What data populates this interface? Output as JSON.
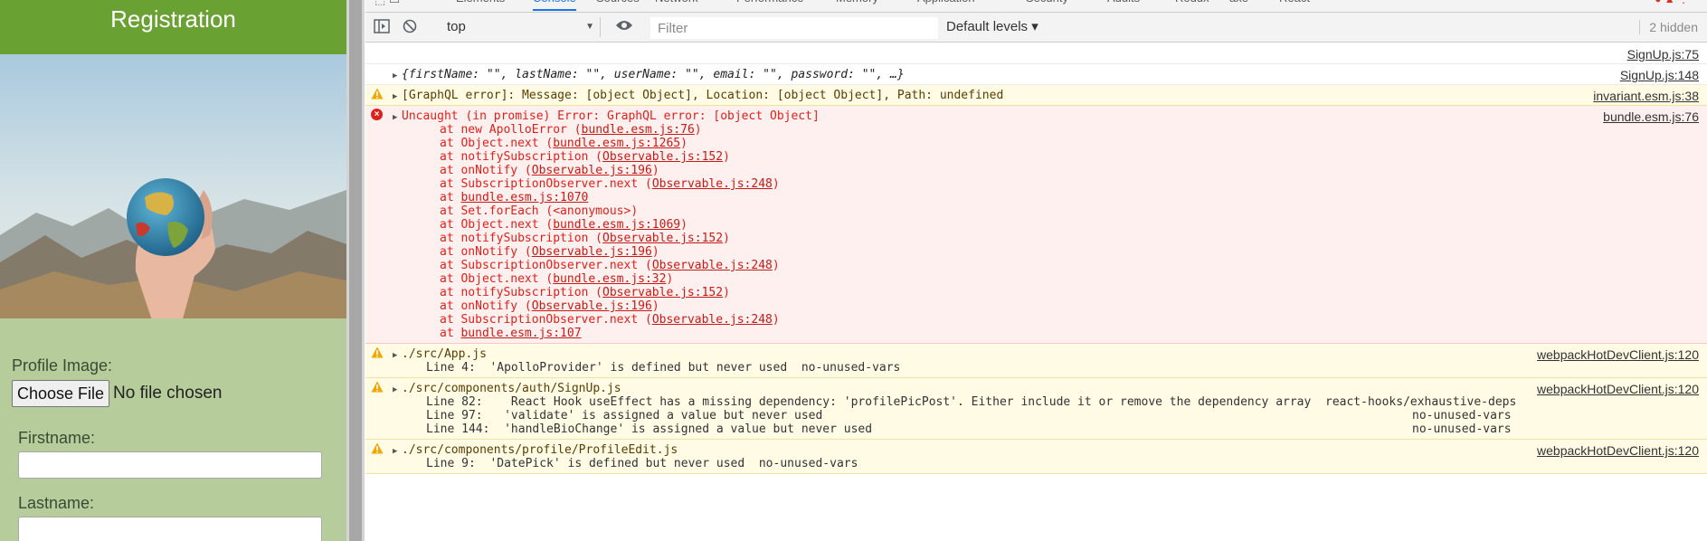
{
  "app": {
    "title": "Registration",
    "profile_image_label": "Profile Image:",
    "choose_file_label": "Choose File",
    "file_status": "No file chosen",
    "firstname_label": "Firstname:",
    "lastname_label": "Lastname:"
  },
  "devtools": {
    "tabs": [
      "Elements",
      "Console",
      "Sources",
      "Network",
      "Performance",
      "Memory",
      "Application",
      "Security",
      "Audits",
      "Redux",
      "axe",
      "React"
    ],
    "active_tab": "Console",
    "context": "top",
    "filter_placeholder": "Filter",
    "levels_label": "Default levels ▾",
    "hidden_count": "2 hidden",
    "messages": [
      {
        "type": "log",
        "source": "SignUp.js:75"
      },
      {
        "type": "log",
        "text": "{firstName: \"\", lastName: \"\", userName: \"\", email: \"\", password: \"\", …}",
        "source": "SignUp.js:148"
      },
      {
        "type": "warn",
        "text": "[GraphQL error]: Message: [object Object], Location: [object Object], Path: undefined",
        "source": "invariant.esm.js:38"
      },
      {
        "type": "error",
        "text": "Uncaught (in promise) Error: GraphQL error: [object Object]",
        "source": "bundle.esm.js:76",
        "stack": [
          {
            "pre": "at new ApolloError (",
            "link": "bundle.esm.js:76",
            "post": ")"
          },
          {
            "pre": "at Object.next (",
            "link": "bundle.esm.js:1265",
            "post": ")"
          },
          {
            "pre": "at notifySubscription (",
            "link": "Observable.js:152",
            "post": ")"
          },
          {
            "pre": "at onNotify (",
            "link": "Observable.js:196",
            "post": ")"
          },
          {
            "pre": "at SubscriptionObserver.next (",
            "link": "Observable.js:248",
            "post": ")"
          },
          {
            "pre": "at ",
            "link": "bundle.esm.js:1070",
            "post": ""
          },
          {
            "pre": "at Set.forEach (<anonymous>)",
            "link": "",
            "post": ""
          },
          {
            "pre": "at Object.next (",
            "link": "bundle.esm.js:1069",
            "post": ")"
          },
          {
            "pre": "at notifySubscription (",
            "link": "Observable.js:152",
            "post": ")"
          },
          {
            "pre": "at onNotify (",
            "link": "Observable.js:196",
            "post": ")"
          },
          {
            "pre": "at SubscriptionObserver.next (",
            "link": "Observable.js:248",
            "post": ")"
          },
          {
            "pre": "at Object.next (",
            "link": "bundle.esm.js:32",
            "post": ")"
          },
          {
            "pre": "at notifySubscription (",
            "link": "Observable.js:152",
            "post": ")"
          },
          {
            "pre": "at onNotify (",
            "link": "Observable.js:196",
            "post": ")"
          },
          {
            "pre": "at SubscriptionObserver.next (",
            "link": "Observable.js:248",
            "post": ")"
          },
          {
            "pre": "at ",
            "link": "bundle.esm.js:107",
            "post": ""
          }
        ]
      },
      {
        "type": "warn",
        "text": "./src/App.js",
        "source": "webpackHotDevClient.js:120",
        "lines": [
          {
            "text": "Line 4:  'ApolloProvider' is defined but never used  no-unused-vars",
            "rule": ""
          }
        ]
      },
      {
        "type": "warn",
        "text": "./src/components/auth/SignUp.js",
        "source": "webpackHotDevClient.js:120",
        "lines": [
          {
            "text": "Line 82:    React Hook useEffect has a missing dependency: 'profilePicPost'. Either include it or remove the dependency array  react-hooks/exhaustive-deps",
            "rule": ""
          },
          {
            "text": "Line 97:   'validate' is assigned a value but never used",
            "rule": "no-unused-vars"
          },
          {
            "text": "Line 144:  'handleBioChange' is assigned a value but never used",
            "rule": "no-unused-vars"
          }
        ]
      },
      {
        "type": "warn",
        "text": "./src/components/profile/ProfileEdit.js",
        "source": "webpackHotDevClient.js:120",
        "lines": [
          {
            "text": "Line 9:  'DatePick' is defined but never used  no-unused-vars",
            "rule": ""
          }
        ]
      }
    ]
  }
}
